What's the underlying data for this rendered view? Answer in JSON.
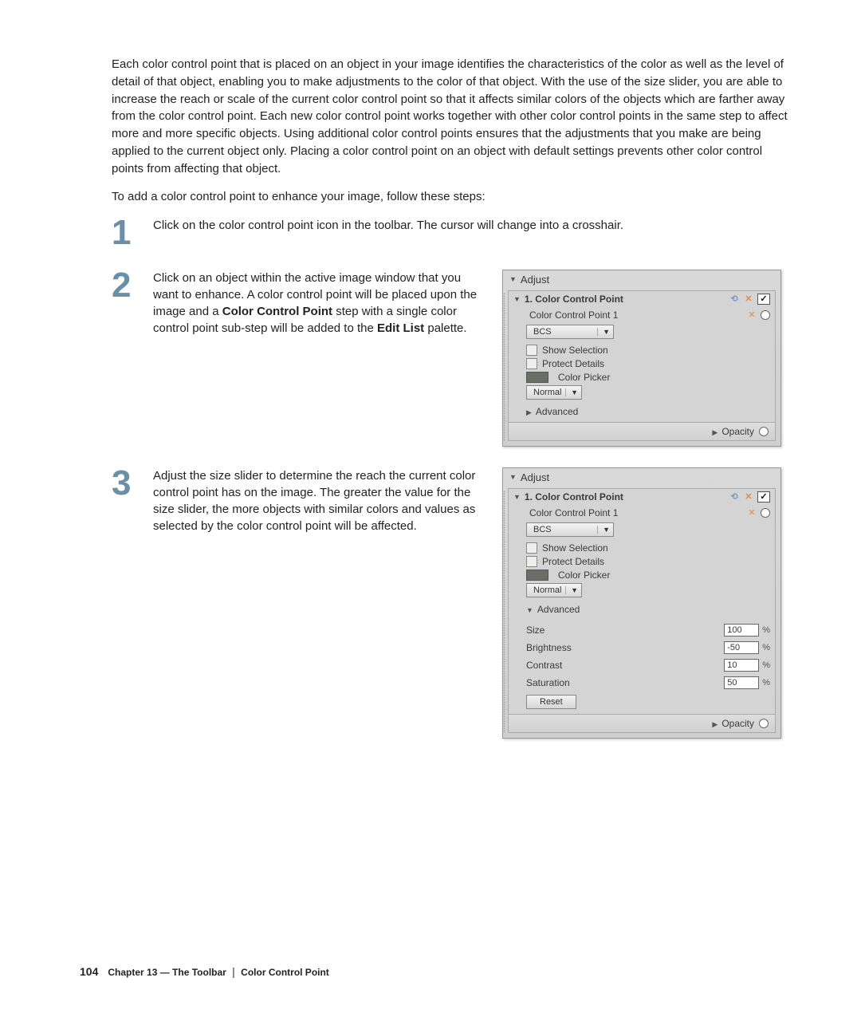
{
  "intro": "Each color control point that is placed on an object in your image identifies the characteristics of the color as well as the level of detail of that object, enabling you to make adjustments to the color of that object. With the use of the size slider, you are able to increase the reach or scale of the current color control point so that it affects similar colors of the objects which are farther away from the color control point. Each new color control point works together with other color control points in the same step to affect more and more specific objects. Using additional color control points ensures that the adjustments that you make are being applied to the current object only. Placing a color control point on an object with default settings prevents other color control points from affecting that object.",
  "subintro": "To add a color control point to enhance your image, follow these steps:",
  "steps": {
    "s1": {
      "num": "1",
      "text": "Click on the color control point icon in the toolbar. The cursor will change into a crosshair."
    },
    "s2": {
      "num": "2",
      "text_before": "Click on an object within the active image window that you want to enhance. A color control point will be placed upon the image and a ",
      "bold1": "Color Control Point",
      "text_mid": " step with a single color control point sub-step will be added to the ",
      "bold2": "Edit List",
      "text_after": " palette."
    },
    "s3": {
      "num": "3",
      "text": "Adjust the size slider to determine the reach the current color control point has on the image. The greater the value for the size slider, the more objects with similar colors and values as selected by the color control point will be affected."
    }
  },
  "panel": {
    "title": "Adjust",
    "section_title": "1. Color Control Point",
    "sub_title": "Color Control Point 1",
    "select_mode": "BCS",
    "opt_show_selection": "Show Selection",
    "opt_protect_details": "Protect Details",
    "opt_color_picker": "Color Picker",
    "select_blend": "Normal",
    "advanced_label": "Advanced",
    "opacity_label": "Opacity",
    "check": "✓",
    "close_x": "✕",
    "adv": {
      "size_label": "Size",
      "size_value": "100",
      "brightness_label": "Brightness",
      "brightness_value": "-50",
      "contrast_label": "Contrast",
      "contrast_value": "10",
      "saturation_label": "Saturation",
      "saturation_value": "50",
      "pct": "%",
      "reset": "Reset"
    }
  },
  "footer": {
    "page": "104",
    "chapter": "Chapter 13 — The Toolbar",
    "sep": "|",
    "topic": "Color Control Point"
  }
}
